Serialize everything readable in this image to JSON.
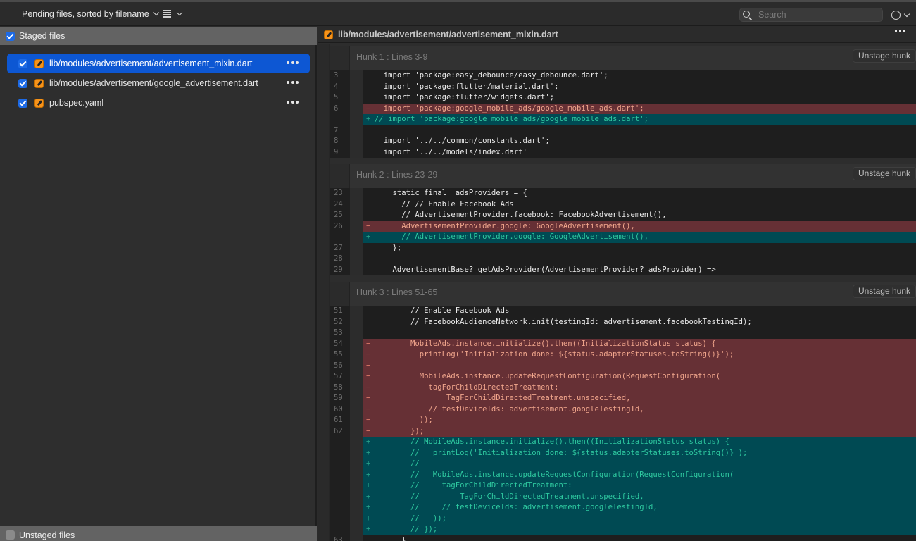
{
  "toolbar": {
    "sort_label": "Pending files, sorted by filename",
    "view_icon": "list-view-icon",
    "search_placeholder": "Search",
    "search_value": "",
    "more_icon": "ellipsis-circle-icon"
  },
  "left_panel": {
    "staged_header": "Staged files",
    "staged_checked": true,
    "files": [
      {
        "path": "lib/modules/advertisement/advertisement_mixin.dart",
        "checked": true,
        "status": "modified",
        "selected": true
      },
      {
        "path": "lib/modules/advertisement/google_advertisement.dart",
        "checked": true,
        "status": "modified",
        "selected": false
      },
      {
        "path": "pubspec.yaml",
        "checked": true,
        "status": "modified",
        "selected": false
      }
    ],
    "unstaged_header": "Unstaged files",
    "unstaged_checked": false
  },
  "diff": {
    "file_path": "lib/modules/advertisement/advertisement_mixin.dart",
    "colors": {
      "removed_bg": "#663035",
      "added_bg": "#004a53",
      "removed_text": "#f0a58c",
      "added_text": "#2ec9a0",
      "selected_row": "#0d57d3",
      "modified_badge": "#f7931a"
    },
    "hunks": [
      {
        "title": "Hunk 1 : Lines 3-9",
        "button": "Unstage hunk",
        "lines": [
          {
            "n": "3",
            "t": " ",
            "c": "  import 'package:easy_debounce/easy_debounce.dart';"
          },
          {
            "n": "4",
            "t": " ",
            "c": "  import 'package:flutter/material.dart';"
          },
          {
            "n": "5",
            "t": " ",
            "c": "  import 'package:flutter/widgets.dart';"
          },
          {
            "n": "6",
            "t": "-",
            "c": "  import 'package:google_mobile_ads/google_mobile_ads.dart';"
          },
          {
            "n": "",
            "t": "+",
            "c": "// import 'package:google_mobile_ads/google_mobile_ads.dart';"
          },
          {
            "n": "7",
            "t": " ",
            "c": ""
          },
          {
            "n": "8",
            "t": " ",
            "c": "  import '../../common/constants.dart';"
          },
          {
            "n": "9",
            "t": " ",
            "c": "  import '../../models/index.dart'"
          }
        ]
      },
      {
        "title": "Hunk 2 : Lines 23-29",
        "button": "Unstage hunk",
        "lines": [
          {
            "n": "23",
            "t": " ",
            "c": "    static final _adsProviders = {"
          },
          {
            "n": "24",
            "t": " ",
            "c": "      // // Enable Facebook Ads"
          },
          {
            "n": "25",
            "t": " ",
            "c": "      // AdvertisementProvider.facebook: FacebookAdvertisement(),"
          },
          {
            "n": "26",
            "t": "-",
            "c": "      AdvertisementProvider.google: GoogleAdvertisement(),"
          },
          {
            "n": "",
            "t": "+",
            "c": "      // AdvertisementProvider.google: GoogleAdvertisement(),"
          },
          {
            "n": "27",
            "t": " ",
            "c": "    };"
          },
          {
            "n": "28",
            "t": " ",
            "c": ""
          },
          {
            "n": "29",
            "t": " ",
            "c": "    AdvertisementBase? getAdsProvider(AdvertisementProvider? adsProvider) =>"
          }
        ]
      },
      {
        "title": "Hunk 3 : Lines 51-65",
        "button": "Unstage hunk",
        "lines": [
          {
            "n": "51",
            "t": " ",
            "c": "        // Enable Facebook Ads"
          },
          {
            "n": "52",
            "t": " ",
            "c": "        // FacebookAudienceNetwork.init(testingId: advertisement.facebookTestingId);"
          },
          {
            "n": "53",
            "t": " ",
            "c": ""
          },
          {
            "n": "54",
            "t": "-",
            "c": "        MobileAds.instance.initialize().then((InitializationStatus status) {"
          },
          {
            "n": "55",
            "t": "-",
            "c": "          printLog('Initialization done: ${status.adapterStatuses.toString()}');"
          },
          {
            "n": "56",
            "t": "-",
            "c": ""
          },
          {
            "n": "57",
            "t": "-",
            "c": "          MobileAds.instance.updateRequestConfiguration(RequestConfiguration("
          },
          {
            "n": "58",
            "t": "-",
            "c": "            tagForChildDirectedTreatment:"
          },
          {
            "n": "59",
            "t": "-",
            "c": "                TagForChildDirectedTreatment.unspecified,"
          },
          {
            "n": "60",
            "t": "-",
            "c": "            // testDeviceIds: advertisement.googleTestingId,"
          },
          {
            "n": "61",
            "t": "-",
            "c": "          ));"
          },
          {
            "n": "62",
            "t": "-",
            "c": "        });"
          },
          {
            "n": "",
            "t": "+",
            "c": "        // MobileAds.instance.initialize().then((InitializationStatus status) {"
          },
          {
            "n": "",
            "t": "+",
            "c": "        //   printLog('Initialization done: ${status.adapterStatuses.toString()}');"
          },
          {
            "n": "",
            "t": "+",
            "c": "        //"
          },
          {
            "n": "",
            "t": "+",
            "c": "        //   MobileAds.instance.updateRequestConfiguration(RequestConfiguration("
          },
          {
            "n": "",
            "t": "+",
            "c": "        //     tagForChildDirectedTreatment:"
          },
          {
            "n": "",
            "t": "+",
            "c": "        //         TagForChildDirectedTreatment.unspecified,"
          },
          {
            "n": "",
            "t": "+",
            "c": "        //     // testDeviceIds: advertisement.googleTestingId,"
          },
          {
            "n": "",
            "t": "+",
            "c": "        //   ));"
          },
          {
            "n": "",
            "t": "+",
            "c": "        // });"
          },
          {
            "n": "63",
            "t": " ",
            "c": "      }"
          }
        ]
      }
    ]
  }
}
